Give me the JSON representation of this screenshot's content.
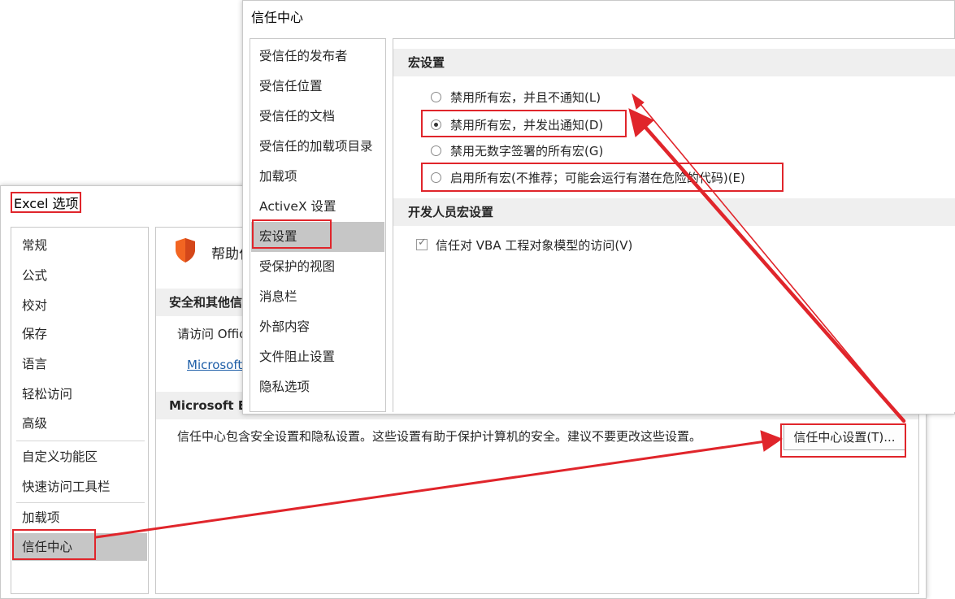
{
  "excel_options": {
    "title": "Excel 选项",
    "nav": [
      "常规",
      "公式",
      "校对",
      "保存",
      "语言",
      "轻松访问",
      "高级",
      "自定义功能区",
      "快速访问工具栏",
      "加载项",
      "信任中心"
    ],
    "selected": "信任中心",
    "help_heading": "帮助仁",
    "section1_header": "安全和其他信",
    "visit_text": "请访问 Offic",
    "microsoft_link": "Microsoft",
    "section2_header": "Microsoft E",
    "desc": "信任中心包含安全设置和隐私设置。这些设置有助于保护计算机的安全。建议不要更改这些设置。",
    "trust_center_button": "信任中心设置(T)..."
  },
  "trust_center": {
    "title": "信任中心",
    "nav": [
      "受信任的发布者",
      "受信任位置",
      "受信任的文档",
      "受信任的加载项目录",
      "加载项",
      "ActiveX 设置",
      "宏设置",
      "受保护的视图",
      "消息栏",
      "外部内容",
      "文件阻止设置",
      "隐私选项"
    ],
    "selected": "宏设置",
    "macro_header": "宏设置",
    "options": [
      {
        "label": "禁用所有宏，并且不通知(L)",
        "selected": false
      },
      {
        "label": "禁用所有宏，并发出通知(D)",
        "selected": true
      },
      {
        "label": "禁用无数字签署的所有宏(G)",
        "selected": false
      },
      {
        "label": "启用所有宏(不推荐；可能会运行有潜在危险的代码)(E)",
        "selected": false
      }
    ],
    "dev_header": "开发人员宏设置",
    "vba_access": "信任对 VBA 工程对象模型的访问(V)",
    "vba_checked": true
  },
  "colors": {
    "annotation": "#e0252b",
    "selected_bg": "#c6c6c6",
    "section_bg": "#efefef",
    "link": "#1f5fa8",
    "shield": "#f26522"
  }
}
